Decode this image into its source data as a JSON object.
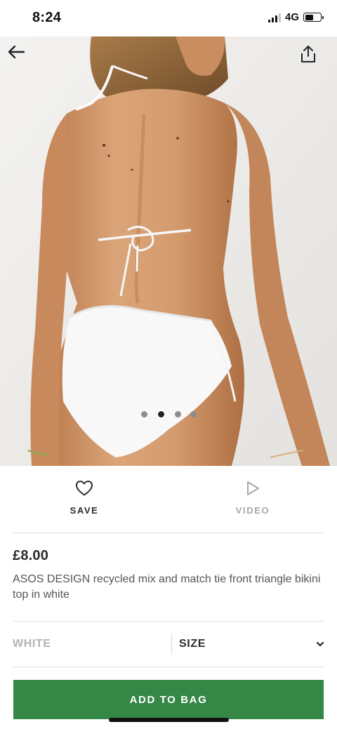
{
  "status_bar": {
    "time": "8:24",
    "network": "4G",
    "battery_level": 0.55
  },
  "gallery": {
    "image_count": 4,
    "active_index": 1
  },
  "actions": {
    "save_label": "SAVE",
    "video_label": "VIDEO"
  },
  "product": {
    "price": "£8.00",
    "name": "ASOS DESIGN recycled mix and match tie front triangle bikini top in white"
  },
  "selectors": {
    "colour": "WHITE",
    "size_label": "SIZE"
  },
  "cta": {
    "add_to_bag_label": "ADD TO BAG",
    "color": "#358745"
  }
}
